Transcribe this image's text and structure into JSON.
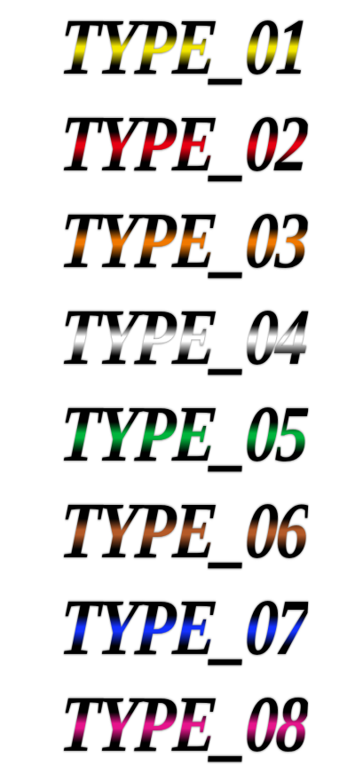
{
  "samples": [
    {
      "text": "TYPE_01",
      "color": "#f2e600"
    },
    {
      "text": "TYPE_02",
      "color": "#e60012"
    },
    {
      "text": "TYPE_03",
      "color": "#f07800"
    },
    {
      "text": "TYPE_04",
      "color": "#ffffff"
    },
    {
      "text": "TYPE_05",
      "color": "#00b43c"
    },
    {
      "text": "TYPE_06",
      "color": "#b45a28"
    },
    {
      "text": "TYPE_07",
      "color": "#1432ff"
    },
    {
      "text": "TYPE_08",
      "color": "#e6148c"
    }
  ]
}
